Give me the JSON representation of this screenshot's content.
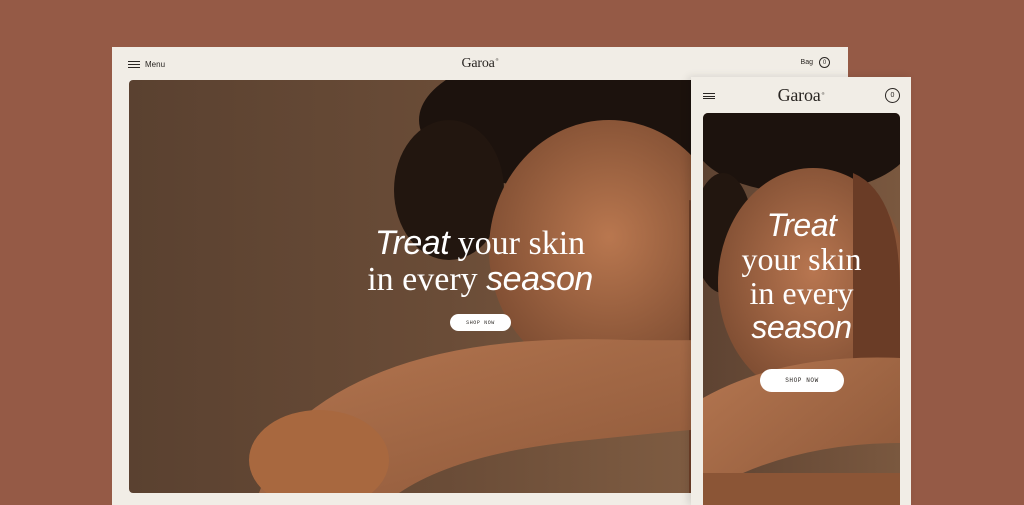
{
  "colors": {
    "background": "#955a46",
    "frame": "#f1ede6",
    "text": "#2a2623",
    "hero_text": "#ffffff",
    "cta_background": "#ffffff"
  },
  "desktop": {
    "header": {
      "menu_icon": "hamburger-icon",
      "menu_label": "Menu",
      "logo": "Garoa",
      "logo_mark": "®",
      "bag_label": "Bag",
      "bag_count": "0"
    },
    "hero": {
      "headline_line1_italic": "Treat",
      "headline_line1_rest": " your skin",
      "headline_line2_start": "in every ",
      "headline_line2_italic": "season",
      "cta_label": "SHOP NOW"
    }
  },
  "mobile": {
    "header": {
      "menu_icon": "hamburger-icon",
      "logo": "Garoa",
      "logo_mark": "®",
      "bag_count": "0"
    },
    "hero": {
      "headline_line1_italic": "Treat",
      "headline_line2": "your skin",
      "headline_line3": "in every",
      "headline_line4_italic": "season",
      "cta_label": "SHOP NOW"
    }
  }
}
